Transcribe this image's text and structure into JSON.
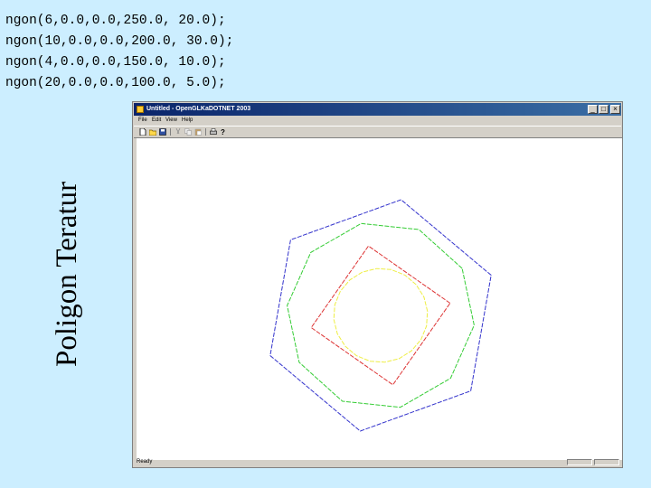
{
  "code_lines": [
    "ngon(6,0.0,0.0,250.0, 20.0);",
    "ngon(10,0.0,0.0,200.0, 30.0);",
    "ngon(4,0.0,0.0,150.0, 10.0);",
    "ngon(20,0.0,0.0,100.0, 5.0);"
  ],
  "side_title": "Poligon Teratur",
  "window": {
    "title": "Untitled - OpenGLKaDOTNET 2003",
    "menu": [
      "File",
      "Edit",
      "View",
      "Help"
    ],
    "status": "Ready",
    "toolbar_icons": [
      "new-icon",
      "open-icon",
      "save-icon",
      "cut-icon",
      "copy-icon",
      "paste-icon",
      "print-icon",
      "help-icon"
    ]
  },
  "polygons": [
    {
      "sides": 6,
      "color": "#3333cc"
    },
    {
      "sides": 10,
      "color": "#33cc33"
    },
    {
      "sides": 4,
      "color": "#dd3333"
    },
    {
      "sides": 20,
      "color": "#eeee44"
    }
  ]
}
